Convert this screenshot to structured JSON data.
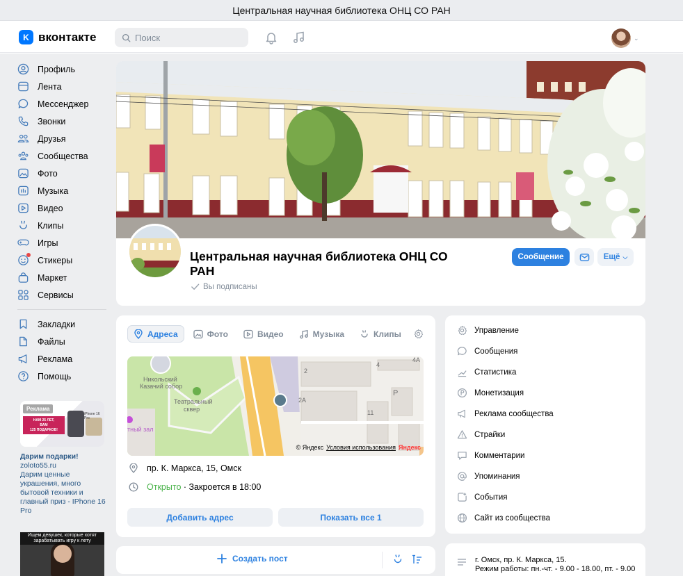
{
  "window": {
    "title": "Центральная научная библиотека ОНЦ СО РАН"
  },
  "topnav": {
    "logo_text": "вконтакте",
    "logo_mark": "K",
    "search_placeholder": "Поиск",
    "icons": [
      "bell-icon",
      "music-note-icon"
    ]
  },
  "sidebar": {
    "items": [
      {
        "label": "Профиль",
        "icon": "user-circle-icon"
      },
      {
        "label": "Лента",
        "icon": "feed-icon"
      },
      {
        "label": "Мессенджер",
        "icon": "chat-bubble-icon"
      },
      {
        "label": "Звонки",
        "icon": "phone-icon"
      },
      {
        "label": "Друзья",
        "icon": "friends-icon"
      },
      {
        "label": "Сообщества",
        "icon": "communities-icon"
      },
      {
        "label": "Фото",
        "icon": "photo-icon"
      },
      {
        "label": "Музыка",
        "icon": "music-icon"
      },
      {
        "label": "Видео",
        "icon": "video-icon"
      },
      {
        "label": "Клипы",
        "icon": "clips-icon"
      },
      {
        "label": "Игры",
        "icon": "gamepad-icon"
      },
      {
        "label": "Стикеры",
        "icon": "sticker-icon"
      },
      {
        "label": "Маркет",
        "icon": "market-bag-icon"
      },
      {
        "label": "Сервисы",
        "icon": "services-grid-icon"
      }
    ],
    "secondary_items": [
      {
        "label": "Закладки",
        "icon": "bookmark-icon"
      },
      {
        "label": "Файлы",
        "icon": "file-icon"
      },
      {
        "label": "Реклама",
        "icon": "megaphone-icon"
      },
      {
        "label": "Помощь",
        "icon": "help-circle-icon"
      }
    ]
  },
  "ad": {
    "tag": "Реклама",
    "banner_line1": "НАМ 25 ЛЕТ,",
    "banner_line2": "ВАМ",
    "banner_line3": "125 ПОДАРКОВ!",
    "phone_label": "iPhone 16 Pro",
    "title": "Дарим подарки!",
    "domain": "zoloto55.ru",
    "description": "Дарим ценные украшения, много бытовой техники и главный приз - IPhone 16 Pro",
    "second_ad_text": "Ищем девушек, которые хотят зарабатывать игру к лету"
  },
  "group": {
    "name": "Центральная научная библиотека ОНЦ СО РАН",
    "subscribed_label": "Вы подписаны",
    "message_button": "Сообщение",
    "more_button": "Ещё"
  },
  "addresses": {
    "tabs": [
      {
        "label": "Адреса",
        "icon": "location-pin-icon",
        "active": true
      },
      {
        "label": "Фото",
        "icon": "photo-icon",
        "active": false
      },
      {
        "label": "Видео",
        "icon": "video-icon",
        "active": false
      },
      {
        "label": "Музыка",
        "icon": "music-icon",
        "active": false
      },
      {
        "label": "Клипы",
        "icon": "clips-icon",
        "active": false
      }
    ],
    "map": {
      "labels": [
        "Никольский",
        "Казачий собор",
        "Театральный",
        "сквер",
        "тный зал",
        "2",
        "2A",
        "4",
        "4A",
        "11",
        "P"
      ],
      "copyright": "© Яндекс",
      "terms_link": "Условия использования",
      "brand": "Яндекс"
    },
    "address": "пр. К. Маркса, 15, Омск",
    "status_open": "Открыто",
    "status_close": " · Закроется в 18:00",
    "add_address_button": "Добавить адрес",
    "show_all_button": "Показать все 1"
  },
  "manage": {
    "items": [
      {
        "label": "Управление",
        "icon": "settings-gear-icon"
      },
      {
        "label": "Сообщения",
        "icon": "message-icon"
      },
      {
        "label": "Статистика",
        "icon": "stats-trend-icon"
      },
      {
        "label": "Монетизация",
        "icon": "ruble-coin-icon"
      },
      {
        "label": "Реклама сообщества",
        "icon": "megaphone-icon"
      },
      {
        "label": "Страйки",
        "icon": "warning-triangle-icon"
      },
      {
        "label": "Комментарии",
        "icon": "comment-icon"
      },
      {
        "label": "Упоминания",
        "icon": "at-sign-icon"
      },
      {
        "label": "События",
        "icon": "event-icon"
      },
      {
        "label": "Сайт из сообщества",
        "icon": "globe-icon"
      }
    ]
  },
  "post": {
    "create_label": "Создать пост"
  },
  "address_info": {
    "line1": "г. Омск, пр. К. Маркса, 15.",
    "line2": "Режим работы: пн.-чт. - 9.00 - 18.00, пт. - 9.00"
  },
  "colors": {
    "accent": "#2d81e0",
    "brand_blue": "#0077ff",
    "page_bg": "#edeef0",
    "open_green": "#4bb34b"
  }
}
